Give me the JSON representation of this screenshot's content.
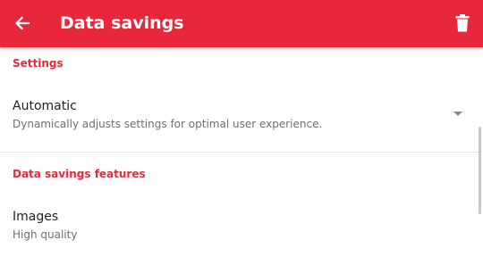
{
  "toolbar": {
    "title": "Data savings",
    "back_icon": "arrow-left-icon",
    "delete_icon": "trash-icon",
    "color": "#e8283a"
  },
  "sections": {
    "settings": {
      "header": "Settings",
      "mode": {
        "title": "Automatic",
        "summary": "Dynamically adjusts settings for optimal user experience."
      }
    },
    "features": {
      "header": "Data savings features",
      "images": {
        "title": "Images",
        "summary": "High quality"
      }
    }
  }
}
